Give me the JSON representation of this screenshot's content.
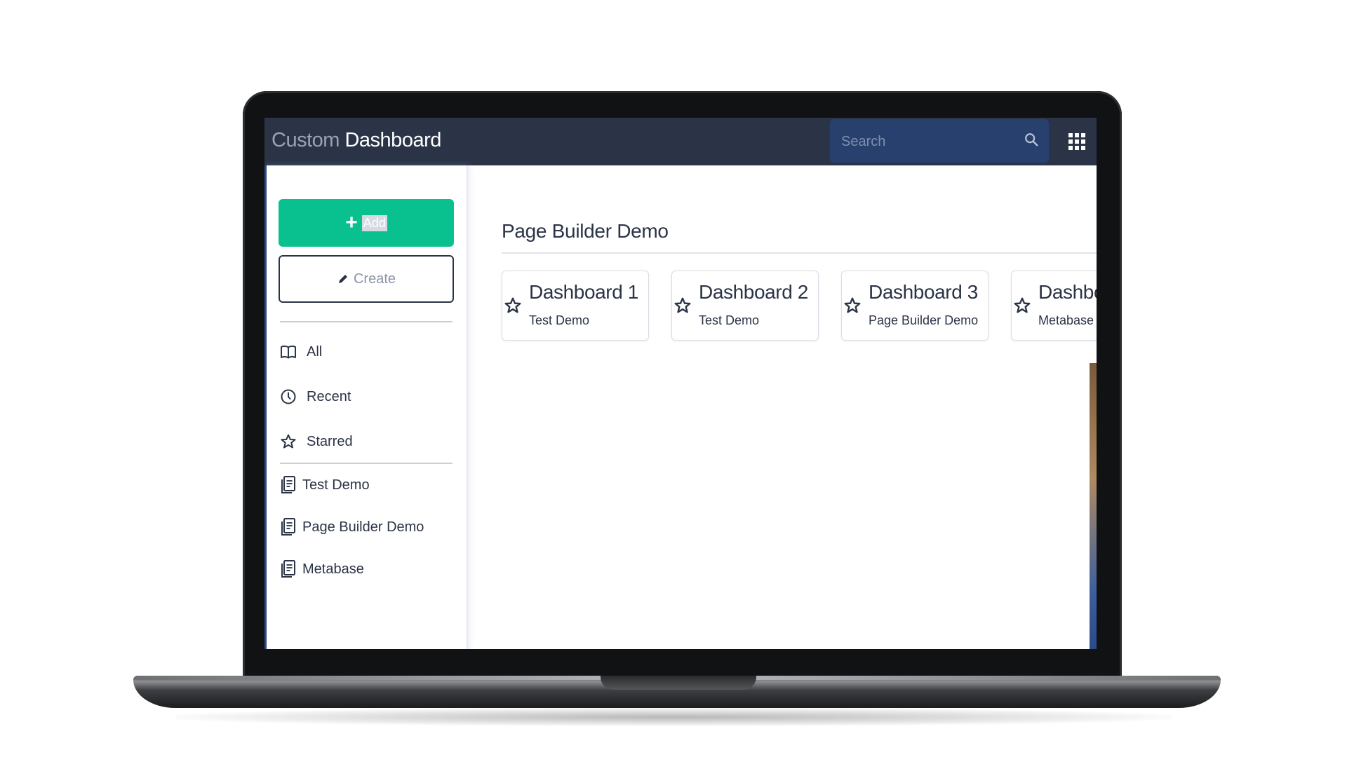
{
  "app": {
    "title_light": "Custom",
    "title_strong": "Dashboard"
  },
  "search": {
    "placeholder": "Search"
  },
  "sidebar": {
    "add_label": "Add",
    "create_label": "Create",
    "nav": [
      {
        "label": "All",
        "icon": "book-icon"
      },
      {
        "label": "Recent",
        "icon": "clock-icon"
      },
      {
        "label": "Starred",
        "icon": "star-icon"
      }
    ],
    "collections": [
      {
        "label": "Test Demo",
        "icon": "document-icon"
      },
      {
        "label": "Page Builder Demo",
        "icon": "document-icon"
      },
      {
        "label": "Metabase",
        "icon": "document-icon"
      }
    ]
  },
  "main": {
    "section_title": "Page Builder Demo",
    "cards": [
      {
        "title": "Dashboard 1",
        "subtitle": "Test Demo"
      },
      {
        "title": "Dashboard 2",
        "subtitle": "Test Demo"
      },
      {
        "title": "Dashboard 3",
        "subtitle": "Page Builder Demo"
      },
      {
        "title": "Dashbo",
        "subtitle": "Metabase"
      }
    ]
  },
  "colors": {
    "topbar": "#2b3446",
    "search_bg": "#27406d",
    "accent_green": "#09c08f",
    "text_dark": "#2b3446"
  }
}
